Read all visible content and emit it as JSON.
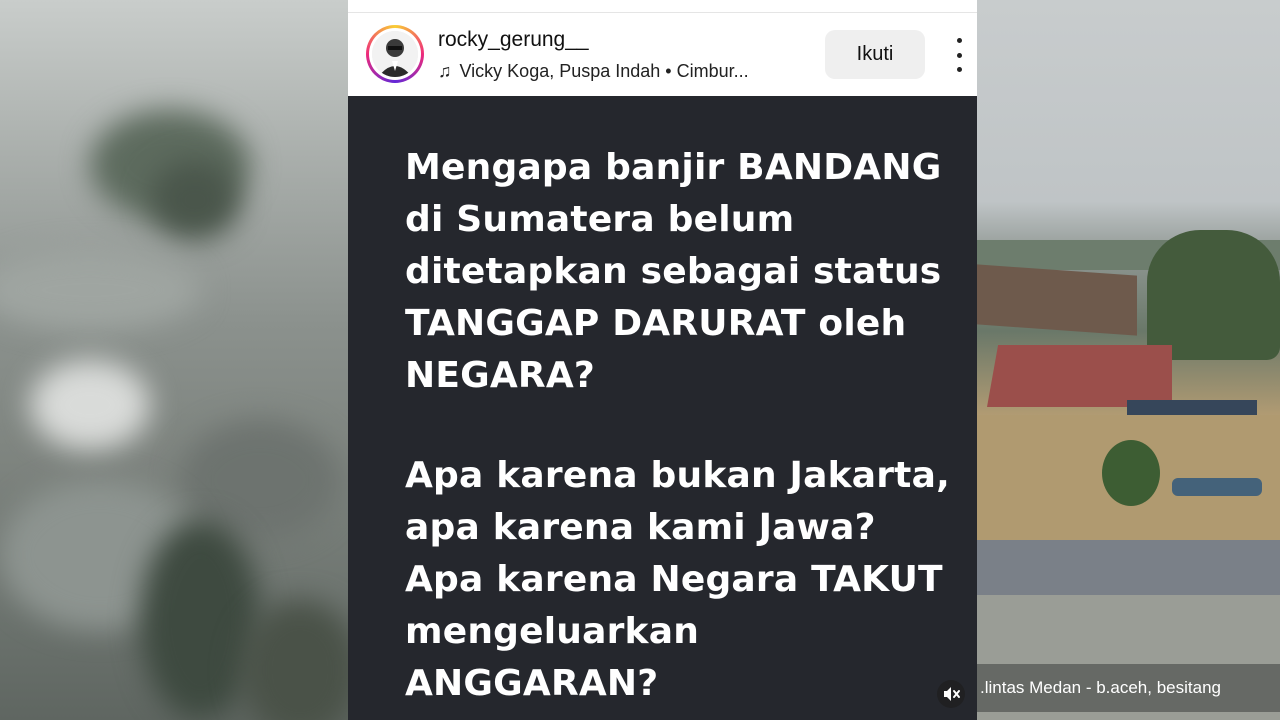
{
  "post": {
    "username": "rocky_gerung__",
    "music_label": "Vicky Koga, Puspa Indah • Cimbur...",
    "follow_label": "Ikuti",
    "paragraph1": "Mengapa banjir BANDANG di Sumatera belum ditetapkan sebagai status TANGGAP DARURAT oleh NEGARA?",
    "paragraph2": "Apa karena bukan Jakarta, apa karena kami Jawa? Apa karena Negara TAKUT mengeluarkan ANGGARAN?"
  },
  "right_video": {
    "caption": ".lintas Medan - b.aceh, besitang"
  },
  "icons": {
    "music": "music-note-icon",
    "more": "more-vertical-icon",
    "mute": "muted-speaker-icon"
  },
  "colors": {
    "content_bg": "#25272d",
    "follow_bg": "#efefef"
  }
}
